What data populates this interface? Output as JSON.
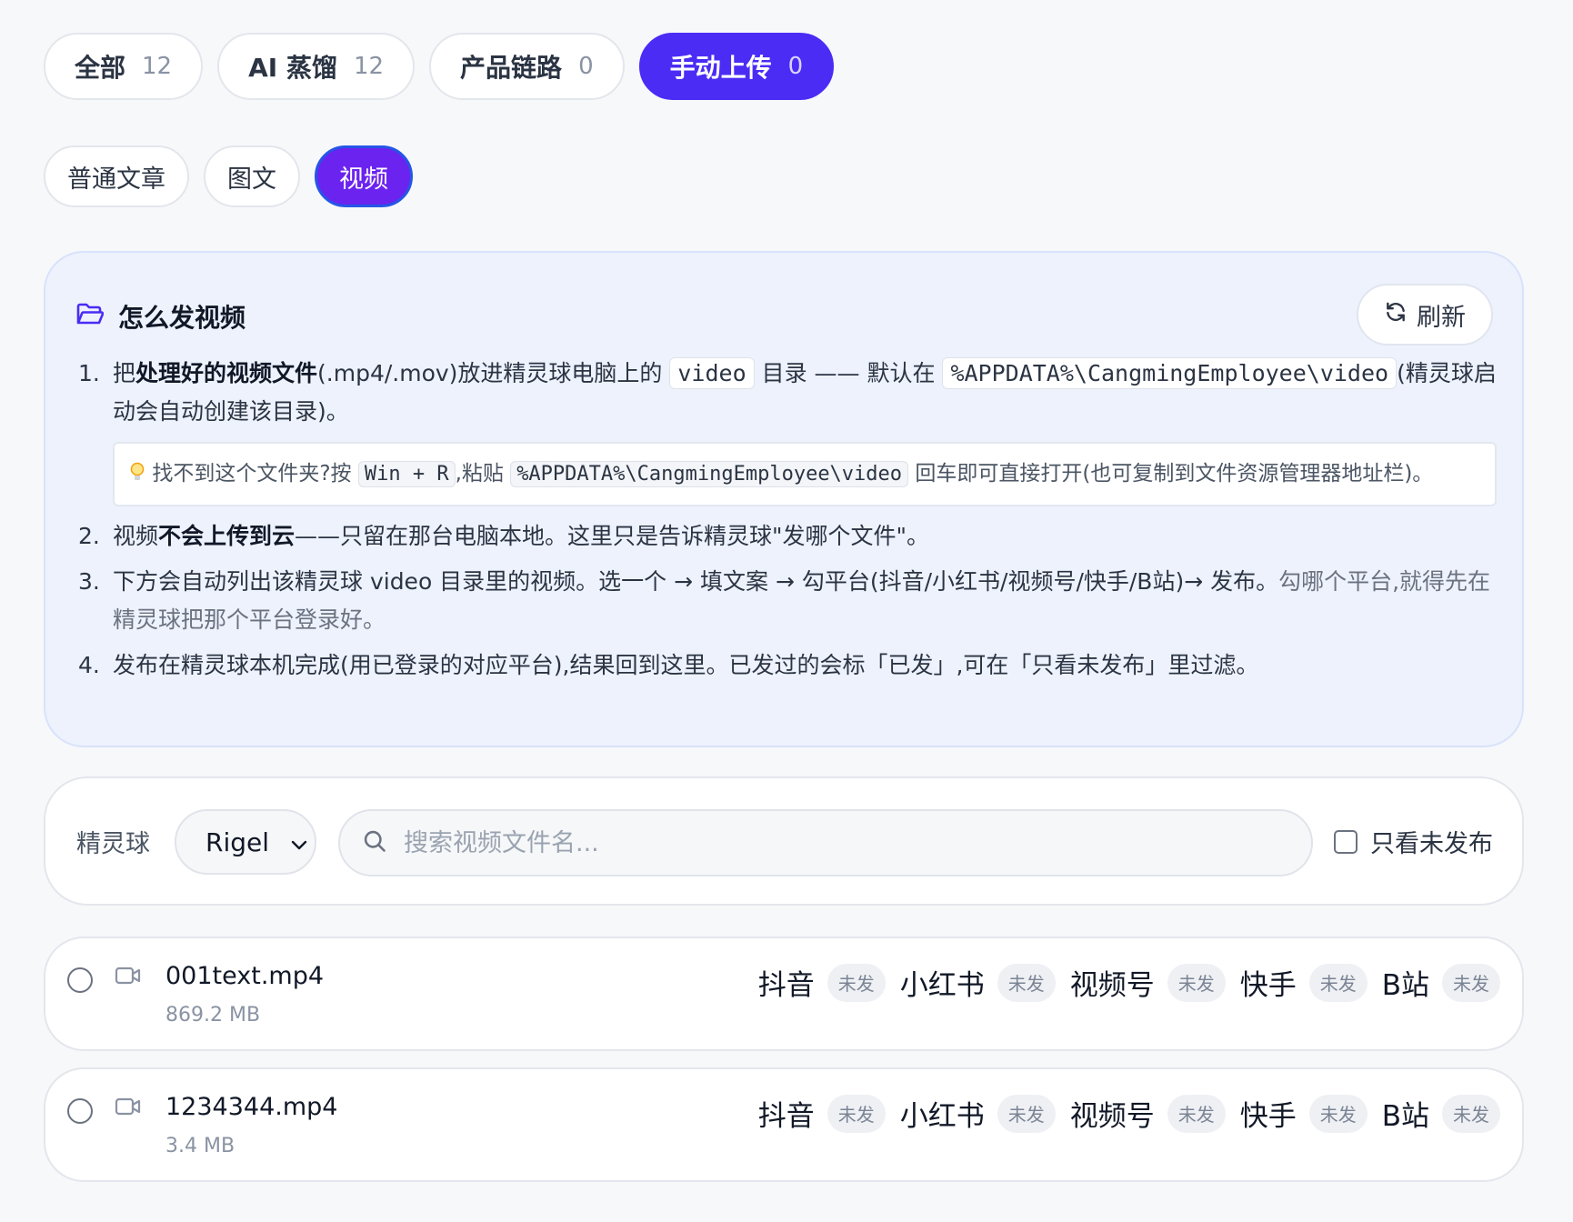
{
  "source_tabs": [
    {
      "label": "全部",
      "count": "12"
    },
    {
      "label": "AI 蒸馏",
      "count": "12"
    },
    {
      "label": "产品链路",
      "count": "0"
    },
    {
      "label": "手动上传",
      "count": "0"
    }
  ],
  "type_tabs": [
    "普通文章",
    "图文",
    "视频"
  ],
  "help": {
    "title": "怎么发视频",
    "refresh_label": "刷新",
    "step1": {
      "num": "1.",
      "pre": "把",
      "bold": "处理好的视频文件",
      "mid1": "(.mp4/.mov)放进精灵球电脑上的 ",
      "code1": "video",
      "mid2": " 目录 —— 默认在 ",
      "code2": "%APPDATA%\\CangmingEmployee\\video",
      "post": "(精灵球启动会自动创建该目录)。"
    },
    "tip": {
      "pre": "找不到这个文件夹?按 ",
      "code1": "Win + R",
      "mid": ",粘贴 ",
      "code2": "%APPDATA%\\CangmingEmployee\\video",
      "post": " 回车即可直接打开(也可复制到文件资源管理器地址栏)。"
    },
    "step2": {
      "num": "2.",
      "pre": "视频",
      "bold": "不会上传到云",
      "post": "——只留在那台电脑本地。这里只是告诉精灵球\"发哪个文件\"。"
    },
    "step3": {
      "num": "3.",
      "main": "下方会自动列出该精灵球 video 目录里的视频。选一个 → 填文案 → 勾平台(抖音/小红书/视频号/快手/B站)→ 发布。",
      "muted": "勾哪个平台,就得先在精灵球把那个平台登录好。"
    },
    "step4": {
      "num": "4.",
      "text": "发布在精灵球本机完成(用已登录的对应平台),结果回到这里。已发过的会标「已发」,可在「只看未发布」里过滤。"
    }
  },
  "filter": {
    "label": "精灵球",
    "select_value": "Rigel",
    "search_placeholder": "搜索视频文件名...",
    "only_unpublished_label": "只看未发布"
  },
  "files": [
    {
      "name": "001text.mp4",
      "size": "869.2 MB",
      "platforms": [
        {
          "name": "抖音",
          "status": "未发"
        },
        {
          "name": "小红书",
          "status": "未发"
        },
        {
          "name": "视频号",
          "status": "未发"
        },
        {
          "name": "快手",
          "status": "未发"
        },
        {
          "name": "B站",
          "status": "未发"
        }
      ]
    },
    {
      "name": "1234344.mp4",
      "size": "3.4 MB",
      "platforms": [
        {
          "name": "抖音",
          "status": "未发"
        },
        {
          "name": "小红书",
          "status": "未发"
        },
        {
          "name": "视频号",
          "status": "未发"
        },
        {
          "name": "快手",
          "status": "未发"
        },
        {
          "name": "B站",
          "status": "未发"
        }
      ]
    }
  ],
  "colors": {
    "active_source_tab": "#4a2cf5",
    "active_type_tab": "#6b23f0",
    "help_bg": "#eef2fd"
  },
  "icons": {
    "help": "folder-open-icon",
    "refresh": "refresh-icon",
    "search": "search-icon",
    "select": "chevron-down-icon",
    "file": "video-camera-icon"
  }
}
